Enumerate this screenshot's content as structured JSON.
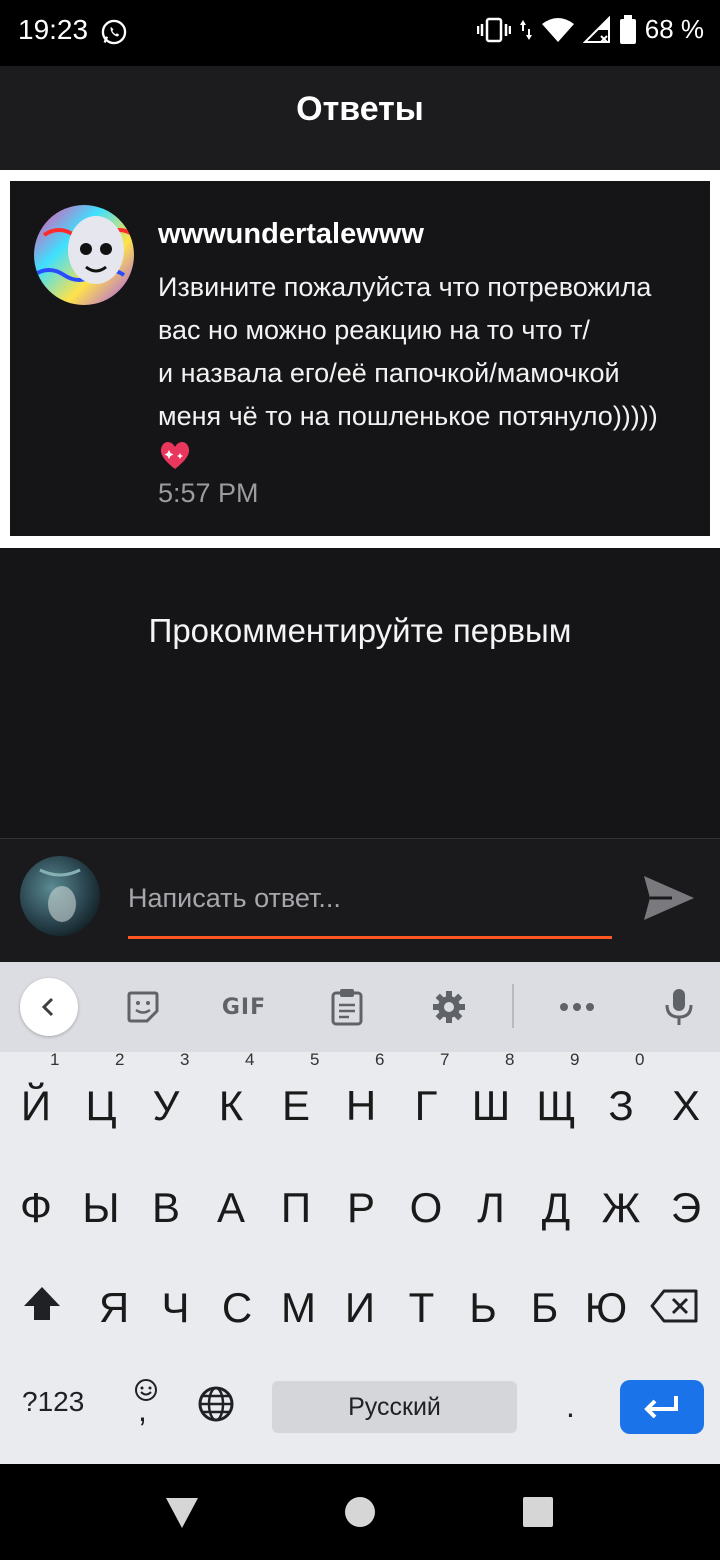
{
  "status_bar": {
    "time": "19:23",
    "battery": "68 %"
  },
  "header": {
    "title": "Ответы"
  },
  "post": {
    "username": "wwwundertalewww",
    "message": "Извините пожалуйста что потревожила\nвас но можно реакцию на то что т/\nи назвала его/её папочкой/мамочкой\nменя чё то на пошленькое потянуло)))))",
    "emoji": "sparkling-heart",
    "time": "5:57 PM"
  },
  "comments": {
    "empty_text": "Прокомментируйте первым"
  },
  "reply": {
    "placeholder": "Написать ответ...",
    "value": ""
  },
  "colors": {
    "accent": "#ff5722",
    "keyboard_enter": "#1a73e8",
    "background": "#151417"
  },
  "keyboard": {
    "toolbar": {
      "gif_label": "GIF"
    },
    "row1": [
      "Й",
      "Ц",
      "У",
      "К",
      "Е",
      "Н",
      "Г",
      "Ш",
      "Щ",
      "З",
      "Х"
    ],
    "row1_numbers": [
      "1",
      "2",
      "3",
      "4",
      "5",
      "6",
      "7",
      "8",
      "9",
      "0"
    ],
    "row2": [
      "Ф",
      "Ы",
      "В",
      "А",
      "П",
      "Р",
      "О",
      "Л",
      "Д",
      "Ж",
      "Э"
    ],
    "row3": [
      "Я",
      "Ч",
      "С",
      "М",
      "И",
      "Т",
      "Ь",
      "Б",
      "Ю"
    ],
    "symbols_label": "?123",
    "comma": ",",
    "space_label": "Русский",
    "period": "."
  }
}
